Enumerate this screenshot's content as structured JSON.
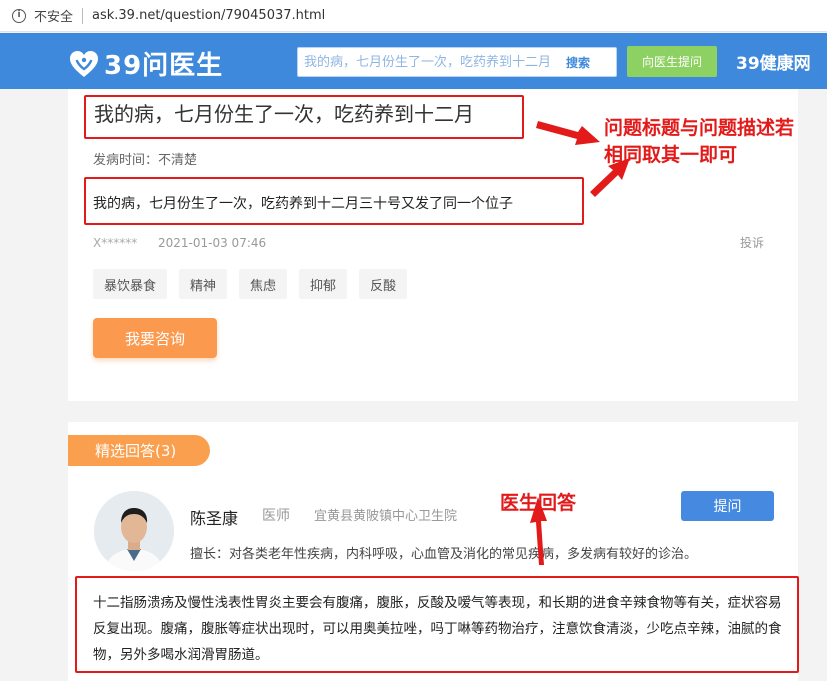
{
  "browser": {
    "security_label": "不安全",
    "url": "ask.39.net/question/79045037.html"
  },
  "header": {
    "logo_text": "39问医生",
    "search_placeholder": "我的病，七月份生了一次，吃药养到十二月",
    "search_button": "搜索",
    "ask_doctor_button": "向医生提问",
    "brand_right": "39健康网",
    "colors": {
      "header_bg": "#3f89dc",
      "ask_button": "#8dd162"
    }
  },
  "question": {
    "title": "我的病，七月份生了一次，吃药养到十二月",
    "onset_time": "发病时间：不清楚",
    "description": "我的病，七月份生了一次，吃药养到十二月三十号又发了同一个位子",
    "author": "X******",
    "date": "2021-01-03 07:46",
    "report": "投诉",
    "tags": [
      "暴饮暴食",
      "精神",
      "焦虑",
      "抑郁",
      "反酸"
    ],
    "consult_button": "我要咨询"
  },
  "answers": {
    "section_title": "精选回答(3)",
    "doctor": {
      "name": "陈圣康",
      "title": "医师",
      "hospital": "宜黄县黄陂镇中心卫生院",
      "specialty": "擅长：对各类老年性疾病，内科呼吸，心血管及消化的常见疾病，多发病有较好的诊治。",
      "ask_button": "提问"
    },
    "content": "十二指肠溃疡及慢性浅表性胃炎主要会有腹痛，腹胀，反酸及嗳气等表现，和长期的进食辛辣食物等有关，症状容易反复出现。腹痛，腹胀等症状出现时，可以用奥美拉唑，吗丁啉等药物治疗，注意饮食清淡，少吃点辛辣，油腻的食物，另外多喝水润滑胃肠道。"
  },
  "annotations": {
    "note_title_desc_line1": "问题标题与问题描述若",
    "note_title_desc_line2": "相同取其一即可",
    "note_doctor_answer": "医生回答",
    "color": "#e21a1a"
  }
}
